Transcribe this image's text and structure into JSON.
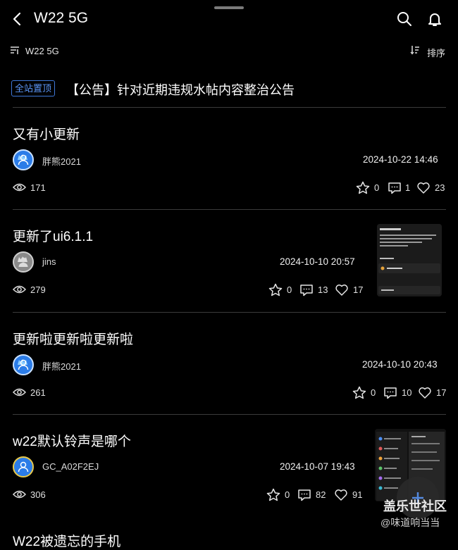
{
  "header": {
    "title": "W22 5G"
  },
  "filter": {
    "label": "W22 5G",
    "sort_label": "排序"
  },
  "notice": {
    "badge": "全站置顶",
    "title": "【公告】针对近期违规水帖内容整治公告"
  },
  "posts": [
    {
      "title": "又有小更新",
      "author": "胖熊2021",
      "date": "2024-10-22 14:46",
      "views": "171",
      "favorites": "0",
      "comments": "1",
      "likes": "23"
    },
    {
      "title": "更新了ui6.1.1",
      "author": "jins",
      "date": "2024-10-10 20:57",
      "views": "279",
      "favorites": "0",
      "comments": "13",
      "likes": "17"
    },
    {
      "title": "更新啦更新啦更新啦",
      "author": "胖熊2021",
      "date": "2024-10-10 20:43",
      "views": "261",
      "favorites": "0",
      "comments": "10",
      "likes": "17"
    },
    {
      "title": "w22默认铃声是哪个",
      "author": "GC_A02F2EJ",
      "date": "2024-10-07 19:43",
      "views": "306",
      "favorites": "0",
      "comments": "82",
      "likes": "91"
    }
  ],
  "next_post_title_partial": "W22被遗忘的手机",
  "watermark": {
    "line1": "盖乐世社区",
    "line2": "@味道响当当"
  },
  "colors": {
    "background": "#000000",
    "accent": "#3f78d9",
    "divider": "#3b3b3b"
  }
}
